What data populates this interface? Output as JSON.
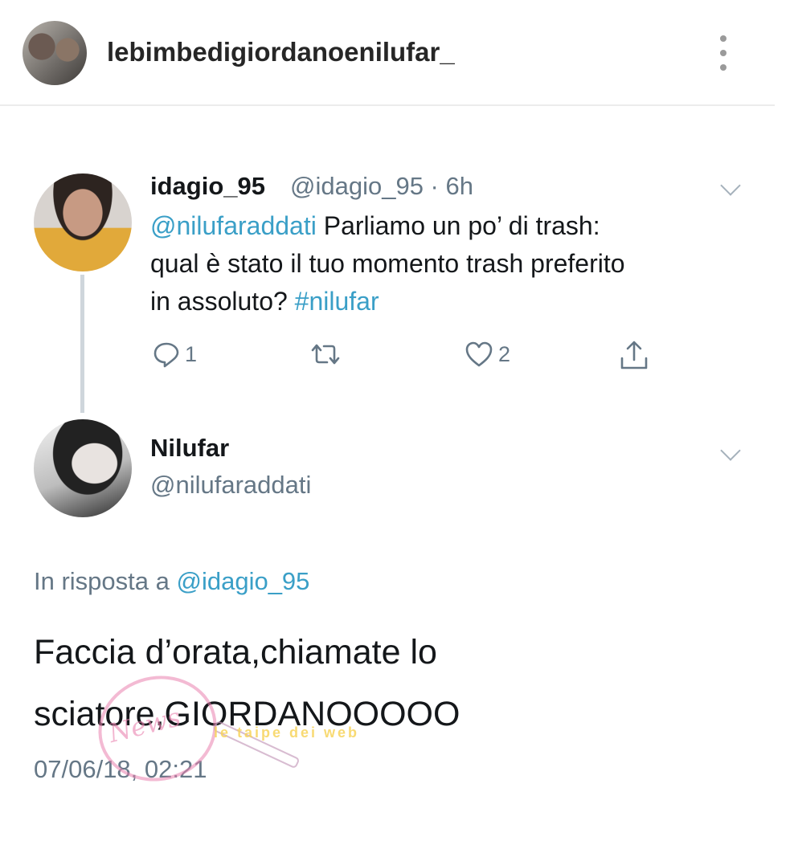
{
  "header": {
    "username": "lebimbedigiordanoenilufar_",
    "more_icon": "more-vertical-icon"
  },
  "tweet": {
    "display_name": "idagio_95",
    "handle_time": "@idagio_95 · 6h",
    "mention": "@nilufaraddati",
    "text_1": " Parliamo un po’ di trash:",
    "text_2": "qual è stato il tuo momento trash preferito",
    "text_3": "in assoluto? ",
    "hashtag": "#nilufar",
    "reply_count": "1",
    "like_count": "2"
  },
  "reply": {
    "display_name": "Nilufar",
    "handle": "@nilufaraddati",
    "reply_to_prefix": "In risposta a ",
    "reply_to_handle": "@idagio_95",
    "text_line_1": "Faccia d’orata,chiamate lo",
    "text_line_2": "sciatore,GIORDANOOOOO",
    "timestamp": "07/06/18, 02:21"
  },
  "watermarks": {
    "stamp_text": "News",
    "banner_text": "le taipe dei web"
  },
  "colors": {
    "link": "#3a9fc7",
    "muted": "#657786",
    "text": "#14171a"
  }
}
